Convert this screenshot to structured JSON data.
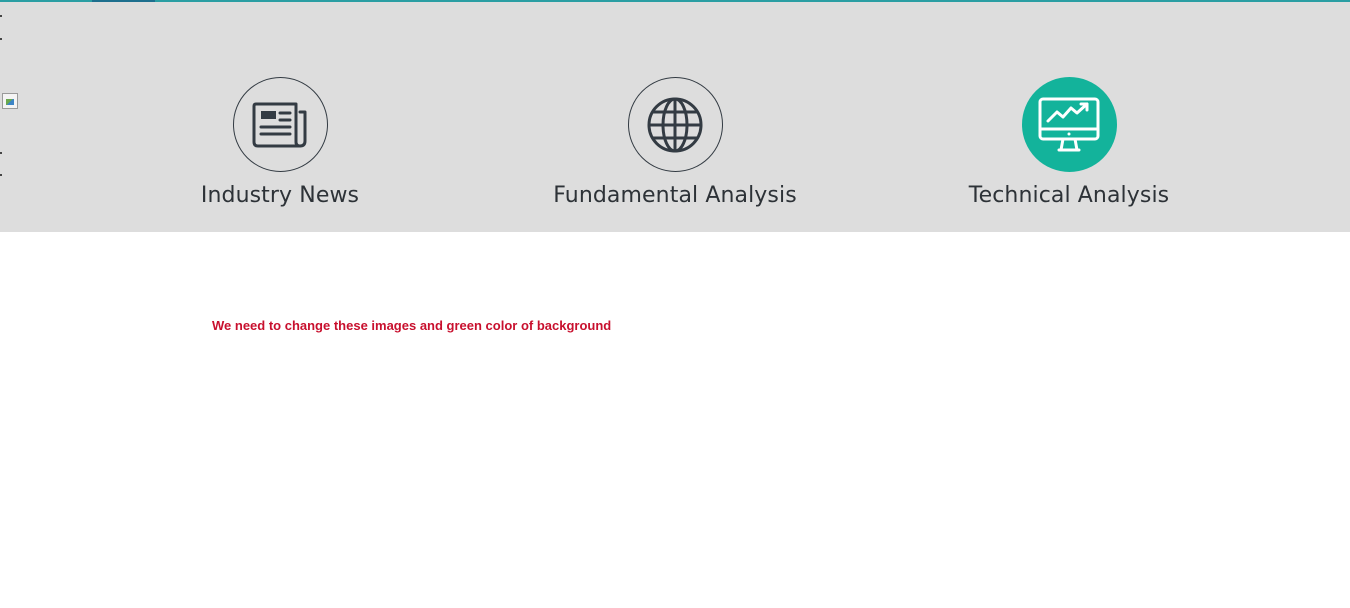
{
  "features": [
    {
      "label": "Industry News",
      "icon": "newspaper-icon",
      "active": false
    },
    {
      "label": "Fundamental Analysis",
      "icon": "globe-icon",
      "active": false
    },
    {
      "label": "Technical Analysis",
      "icon": "monitor-chart-icon",
      "active": true
    }
  ],
  "note": "We need to change these images and green color of background",
  "colors": {
    "band_background": "#dddddd",
    "active_circle": "#13b39b",
    "icon_stroke": "#333b43",
    "note_text": "#c8102e",
    "top_line": "#2a9ea3"
  }
}
